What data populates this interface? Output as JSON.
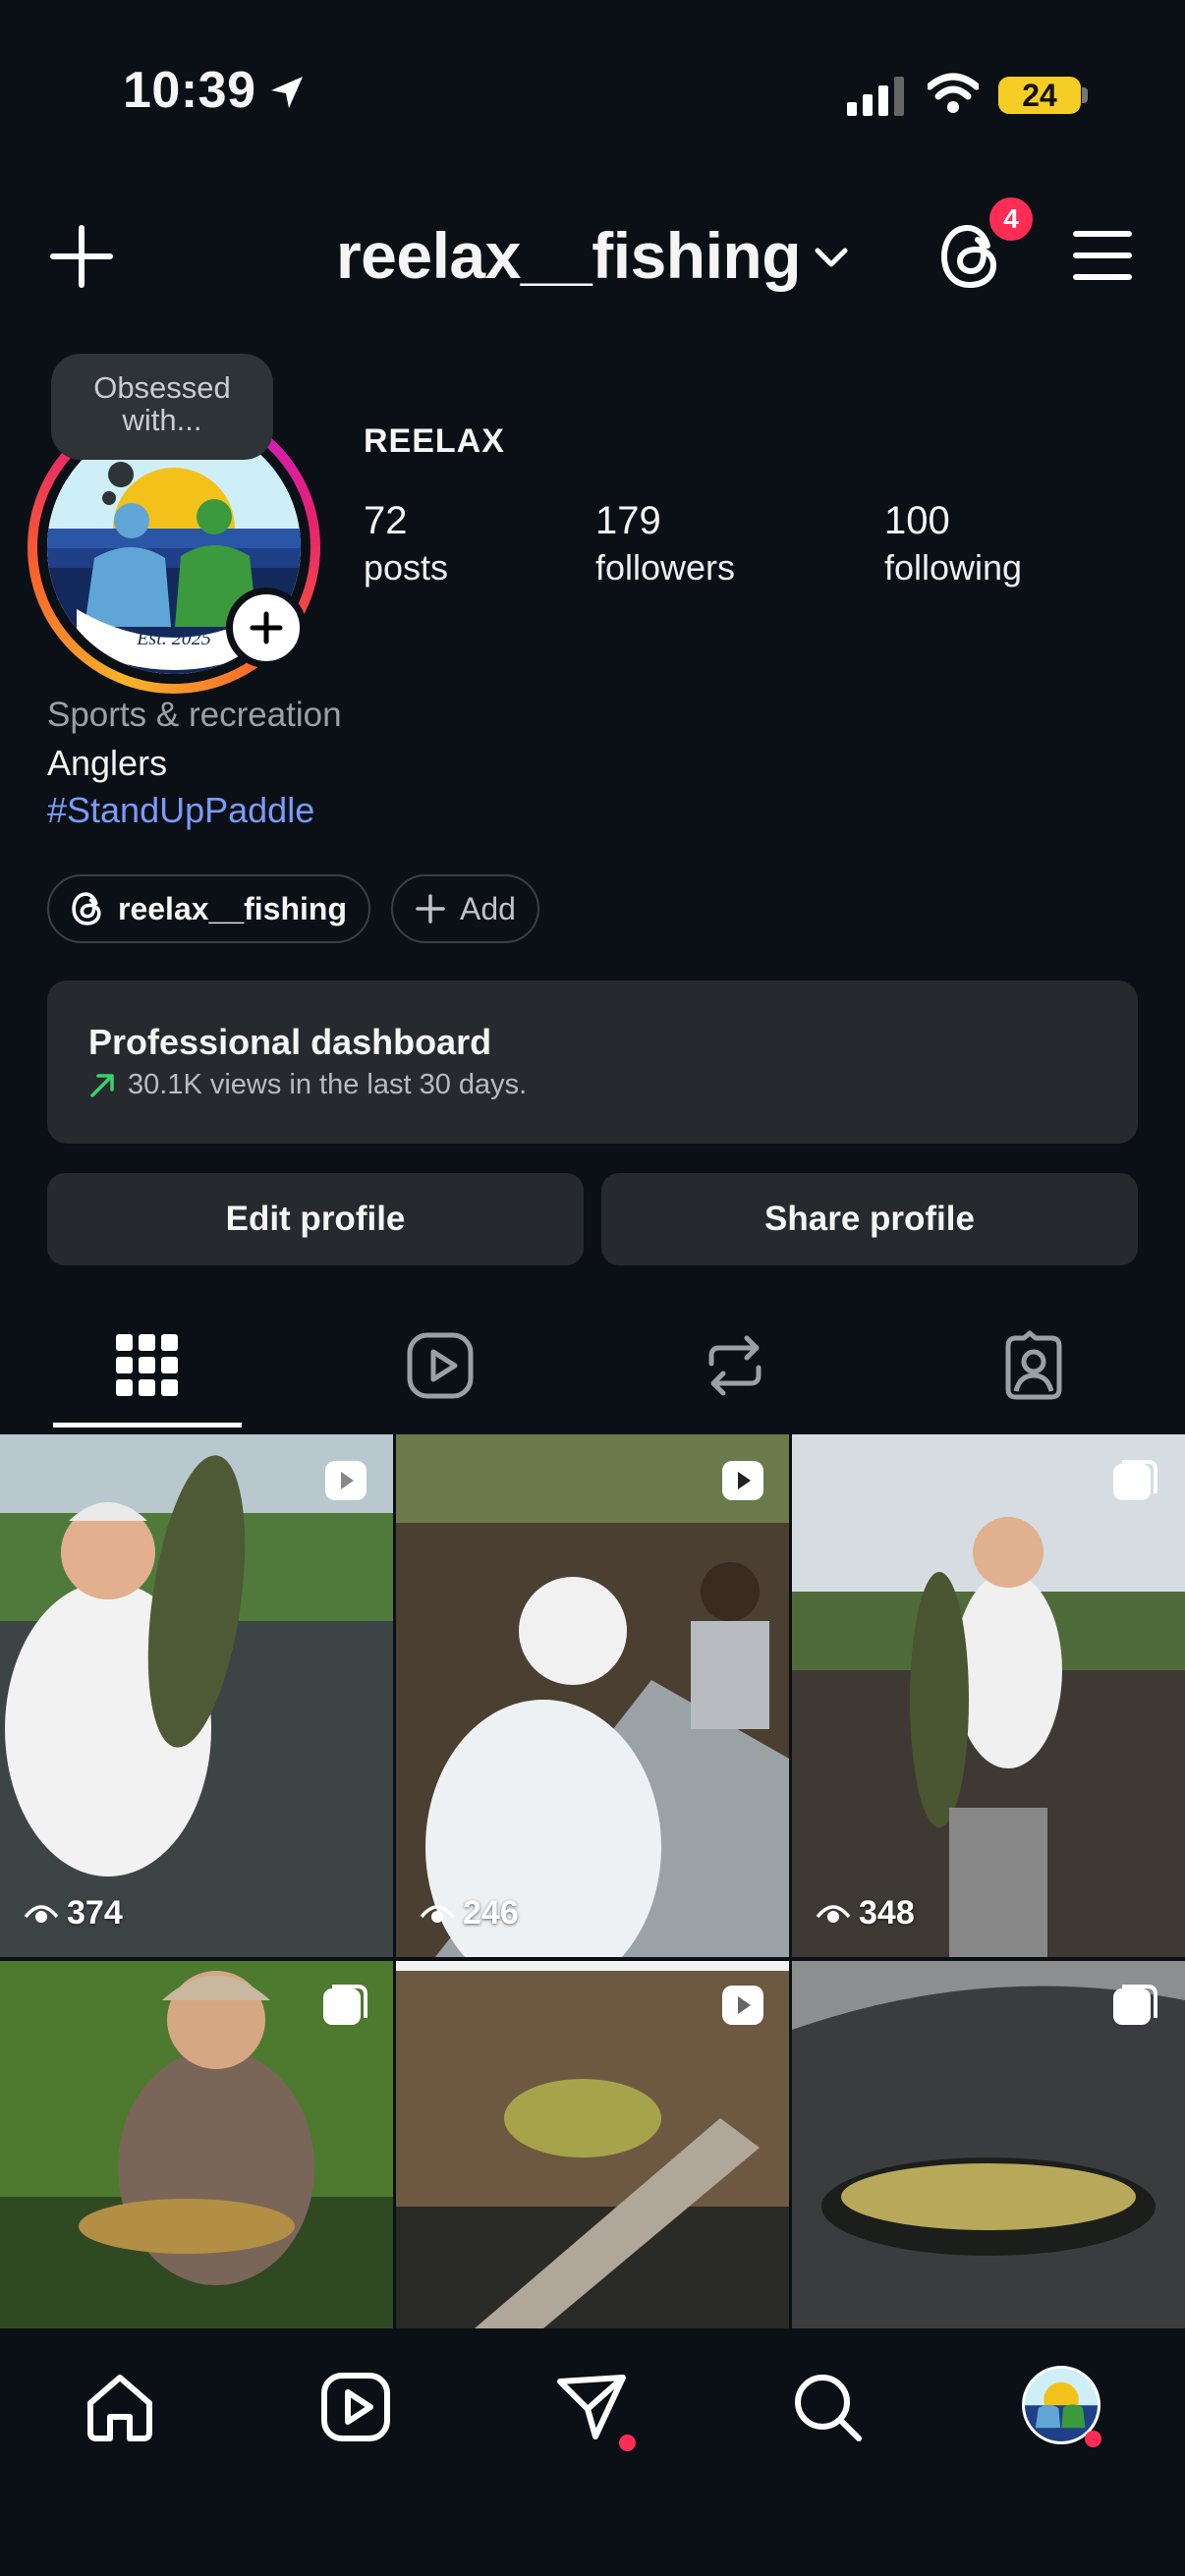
{
  "status": {
    "time": "10:39",
    "battery": "24"
  },
  "header": {
    "username": "reelax__fishing",
    "notification_count": "4"
  },
  "profile": {
    "note": "Obsessed with...",
    "display_name": "REELAX",
    "logo_text": "Est. 2025",
    "stats": [
      {
        "value": "72",
        "label": "posts"
      },
      {
        "value": "179",
        "label": "followers"
      },
      {
        "value": "100",
        "label": "following"
      }
    ],
    "category": "Sports & recreation",
    "bio": "Anglers",
    "hashtag": "#StandUpPaddle",
    "threads_pill": "reelax__fishing",
    "add_pill": "Add"
  },
  "dashboard": {
    "title": "Professional dashboard",
    "subtitle": "30.1K views in the last 30 days."
  },
  "buttons": {
    "edit": "Edit profile",
    "share": "Share profile"
  },
  "tabs": [
    "posts-grid",
    "reels",
    "reposts",
    "tagged"
  ],
  "grid": [
    {
      "views": "374",
      "type": "reel"
    },
    {
      "views": "246",
      "type": "reel"
    },
    {
      "views": "348",
      "type": "carousel"
    },
    {
      "views": "",
      "type": "carousel"
    },
    {
      "views": "",
      "type": "reel"
    },
    {
      "views": "",
      "type": "carousel"
    }
  ],
  "bottom_nav": [
    "home-icon",
    "reels-icon",
    "messages-icon",
    "search-icon",
    "profile-avatar"
  ],
  "colors": {
    "background": "#0b1016",
    "badge": "#ff2d55",
    "hashtag": "#7a9bf6",
    "card": "#262a2f",
    "battery": "#f6cd24"
  }
}
